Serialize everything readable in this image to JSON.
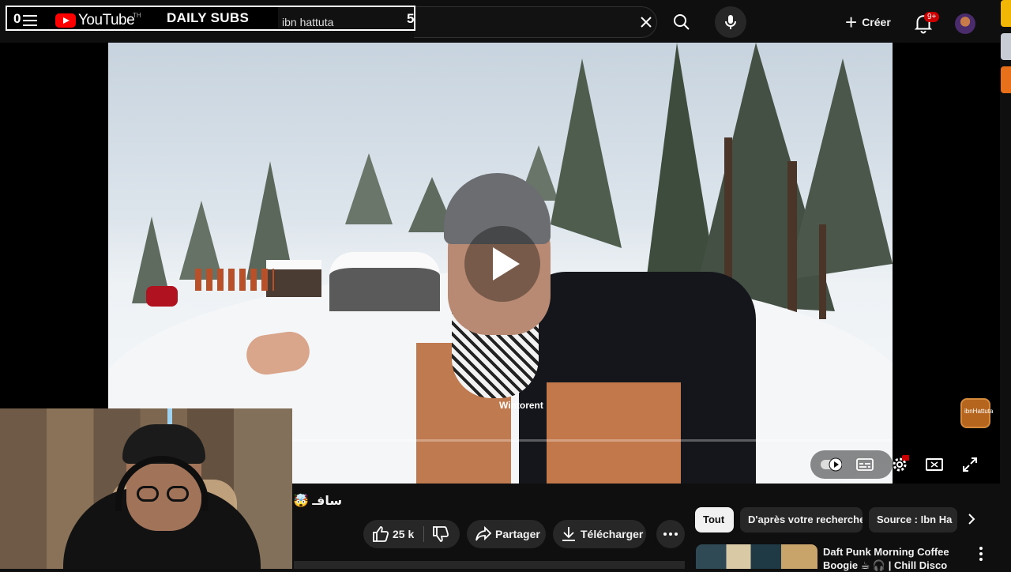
{
  "overlay": {
    "left_counter": "0",
    "title": "DAILY SUBS",
    "search_value": "ibn hattuta",
    "right_counter": "5"
  },
  "header": {
    "logo_text": "YouTube",
    "region": "TH",
    "create_label": "Créer",
    "notifications_badge": "9+"
  },
  "video": {
    "title": "سافـ 🤯",
    "brand_on_jacket": "Wintorent",
    "channel_badge": "ibnHattuta"
  },
  "actions": {
    "like_count": "25 k",
    "share_label": "Partager",
    "download_label": "Télécharger"
  },
  "chips": [
    "Tout",
    "D'après votre recherche",
    "Source : Ibn Ha"
  ],
  "recommendation": {
    "title": "Daft Punk Morning Coffee Boogie ☕ 🎧 | Chill Disco"
  },
  "colors": {
    "background": "#0f0f0f",
    "pill": "#272727",
    "brand_red": "#ff0000",
    "badge_red": "#cc0000"
  },
  "icons": [
    "menu-icon",
    "youtube-logo-icon",
    "close-icon",
    "search-icon",
    "mic-icon",
    "plus-icon",
    "bell-icon",
    "play-icon",
    "autoplay-toggle-icon",
    "subtitles-icon",
    "settings-icon",
    "theater-mode-icon",
    "fullscreen-icon",
    "thumbs-up-icon",
    "thumbs-down-icon",
    "share-icon",
    "download-icon",
    "more-icon",
    "chevron-right-icon",
    "kebab-icon"
  ]
}
